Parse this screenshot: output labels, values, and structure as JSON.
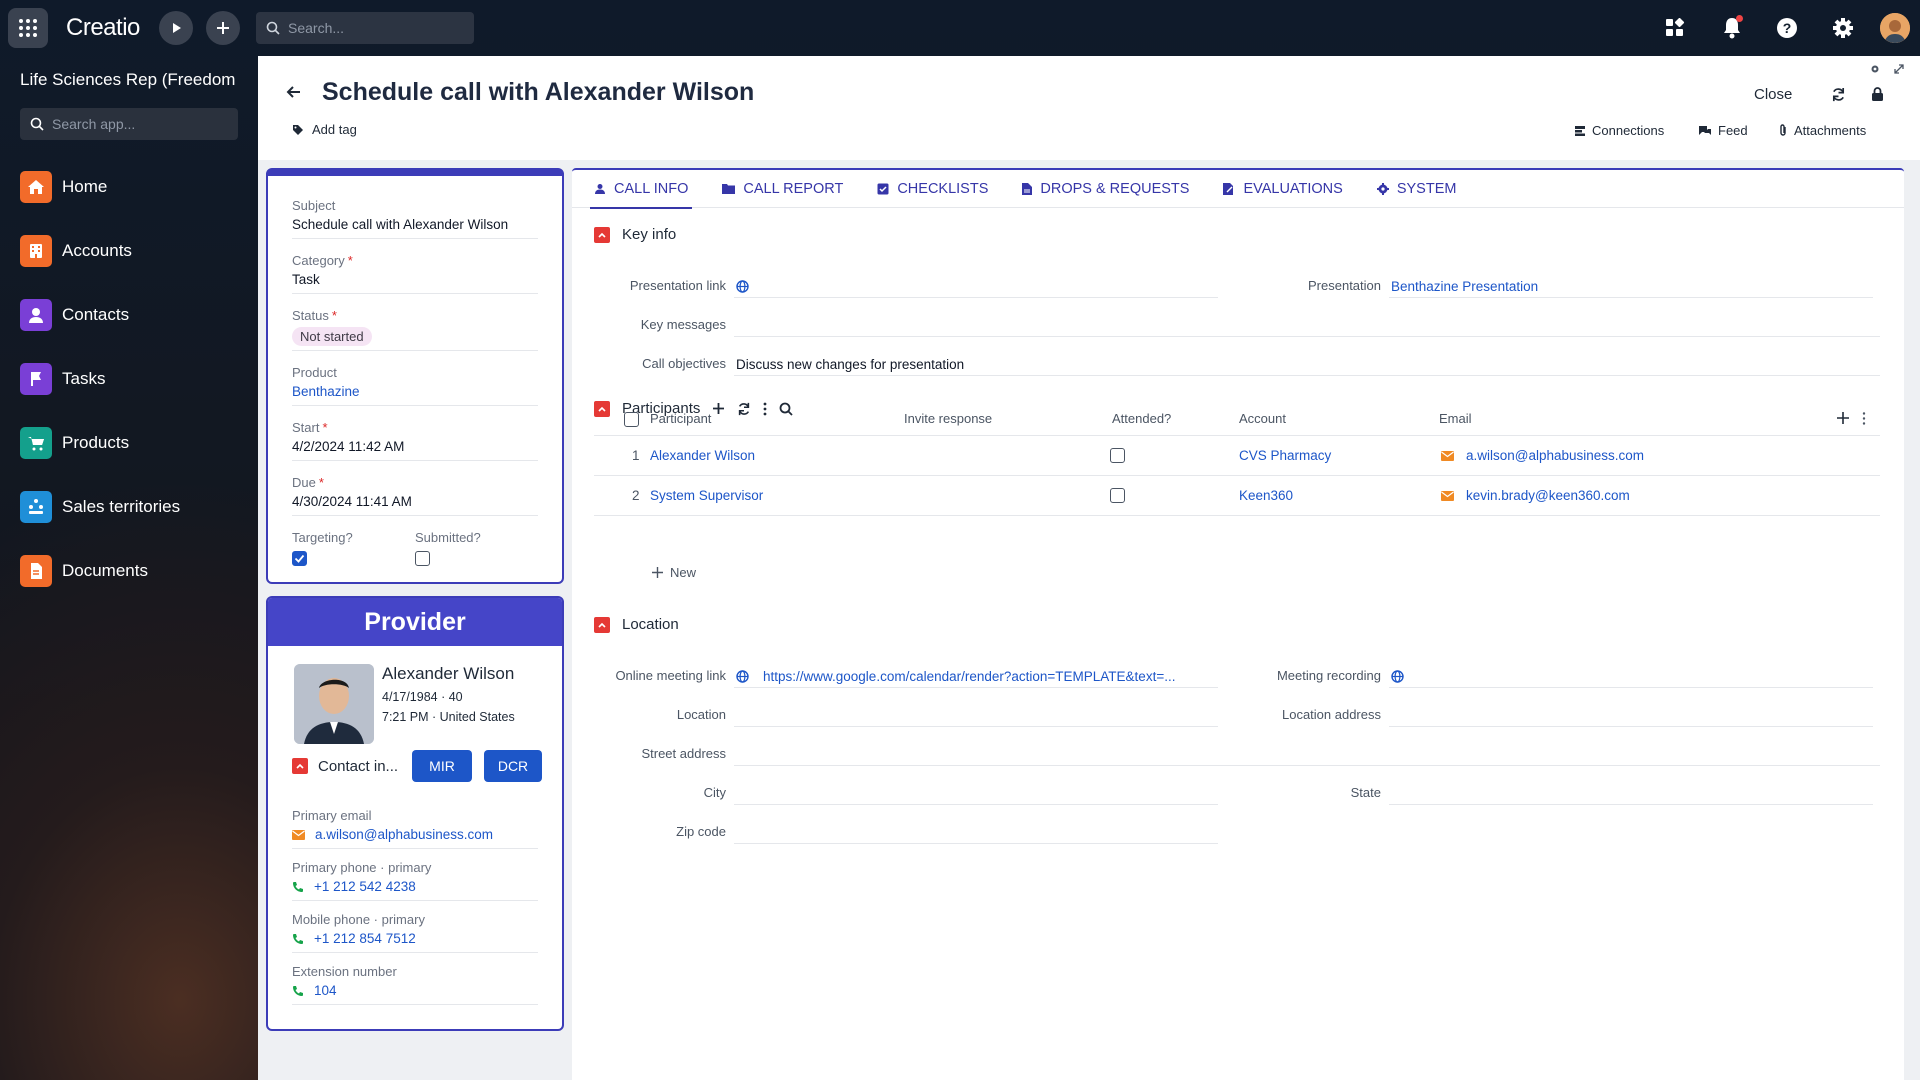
{
  "app": {
    "logo": "Creatio",
    "search_placeholder": "Search..."
  },
  "sidebar": {
    "workspace_title": "Life Sciences Rep (Freedom",
    "search_placeholder": "Search app...",
    "items": [
      {
        "label": "Home",
        "icon": "home-icon",
        "color": "#f26b2a"
      },
      {
        "label": "Accounts",
        "icon": "building-icon",
        "color": "#f26b2a"
      },
      {
        "label": "Contacts",
        "icon": "person-icon",
        "color": "#7a3fd6"
      },
      {
        "label": "Tasks",
        "icon": "flag-icon",
        "color": "#7a3fd6"
      },
      {
        "label": "Products",
        "icon": "cart-icon",
        "color": "#14a08c"
      },
      {
        "label": "Sales territories",
        "icon": "territory-icon",
        "color": "#1f8fd8"
      },
      {
        "label": "Documents",
        "icon": "document-icon",
        "color": "#f26b2a"
      }
    ]
  },
  "header": {
    "title": "Schedule call with Alexander Wilson",
    "add_tag": "Add tag",
    "close": "Close",
    "connections": "Connections",
    "feed": "Feed",
    "attachments": "Attachments"
  },
  "details": {
    "subject_label": "Subject",
    "subject": "Schedule call with Alexander Wilson",
    "category_label": "Category",
    "category": "Task",
    "status_label": "Status",
    "status": "Not started",
    "product_label": "Product",
    "product": "Benthazine",
    "start_label": "Start",
    "start": "4/2/2024 11:42 AM",
    "due_label": "Due",
    "due": "4/30/2024 11:41 AM",
    "targeting_label": "Targeting?",
    "targeting": true,
    "submitted_label": "Submitted?",
    "submitted": false
  },
  "provider": {
    "header": "Provider",
    "name": "Alexander Wilson",
    "line1": "4/17/1984 · 40",
    "line2": "7:21 PM · United States",
    "contact_info": "Contact in...",
    "mir": "MIR",
    "dcr": "DCR",
    "email_label": "Primary email",
    "email": "a.wilson@alphabusiness.com",
    "phone_label": "Primary phone · primary",
    "phone": "+1 212 542 4238",
    "mobile_label": "Mobile phone · primary",
    "mobile": "+1 212 854 7512",
    "ext_label": "Extension number",
    "ext": "104"
  },
  "tabs": [
    {
      "label": "CALL INFO",
      "icon": "call-info-icon",
      "active": true
    },
    {
      "label": "CALL REPORT",
      "icon": "folder-icon",
      "active": false
    },
    {
      "label": "CHECKLISTS",
      "icon": "checklist-icon",
      "active": false
    },
    {
      "label": "DROPS & REQUESTS",
      "icon": "file-icon",
      "active": false
    },
    {
      "label": "EVALUATIONS",
      "icon": "pen-icon",
      "active": false
    },
    {
      "label": "SYSTEM",
      "icon": "gear-icon",
      "active": false
    }
  ],
  "key_info": {
    "title": "Key info",
    "presentation_link_label": "Presentation link",
    "presentation_label": "Presentation",
    "presentation": "Benthazine Presentation",
    "key_messages_label": "Key messages",
    "call_objectives_label": "Call objectives",
    "call_objectives": "Discuss new changes for presentation"
  },
  "participants": {
    "title": "Participants",
    "columns": [
      "Participant",
      "Invite response",
      "Attended?",
      "Account",
      "Email"
    ],
    "rows": [
      {
        "num": "1",
        "participant": "Alexander Wilson",
        "attended": false,
        "account": "CVS Pharmacy",
        "email": "a.wilson@alphabusiness.com"
      },
      {
        "num": "2",
        "participant": "System Supervisor",
        "attended": false,
        "account": "Keen360",
        "email": "kevin.brady@keen360.com"
      }
    ],
    "new_label": "New"
  },
  "location": {
    "title": "Location",
    "online_meeting_label": "Online meeting link",
    "online_meeting": "https://www.google.com/calendar/render?action=TEMPLATE&text=...",
    "meeting_recording_label": "Meeting recording",
    "location_label": "Location",
    "location_address_label": "Location address",
    "street_label": "Street address",
    "city_label": "City",
    "state_label": "State",
    "zip_label": "Zip code"
  },
  "colors": {
    "accent": "#3c3cb8",
    "link": "#1d56c8",
    "collapse": "#e53935"
  }
}
